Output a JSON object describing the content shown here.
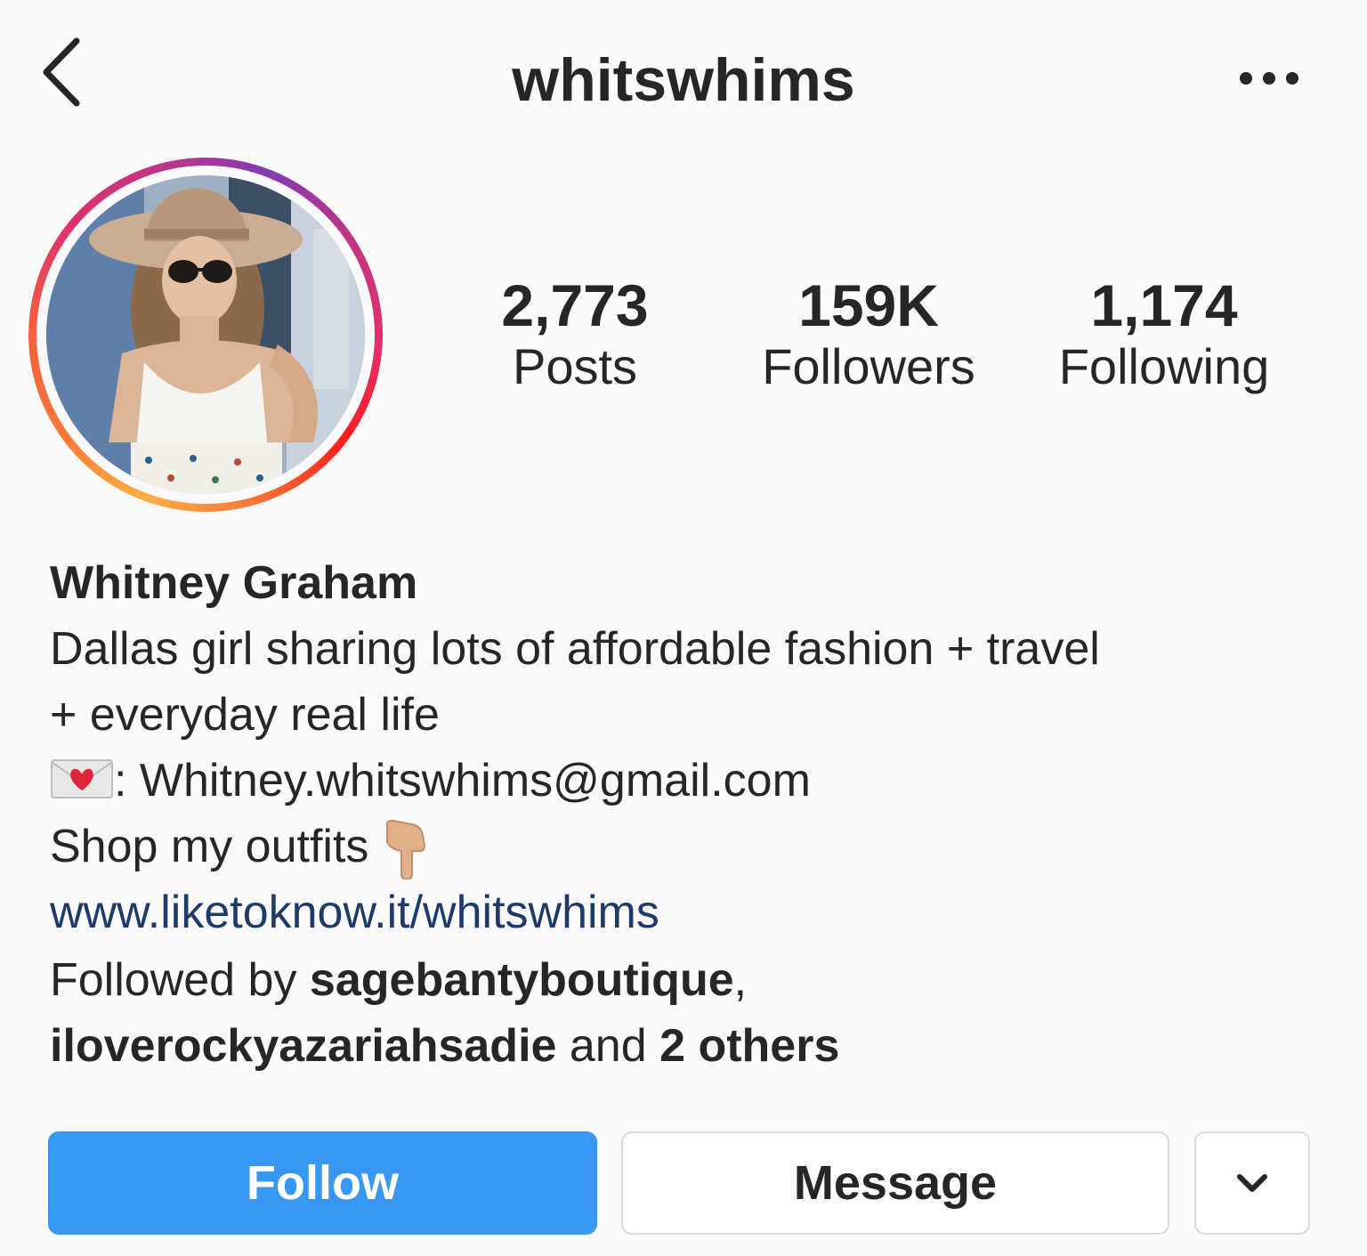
{
  "header": {
    "username": "whitswhims",
    "back_icon": "chevron-left-icon",
    "more_icon": "ellipsis-icon"
  },
  "stats": {
    "posts": {
      "value": "2,773",
      "label": "Posts"
    },
    "followers": {
      "value": "159K",
      "label": "Followers"
    },
    "following": {
      "value": "1,174",
      "label": "Following"
    }
  },
  "bio": {
    "full_name": "Whitney Graham",
    "line1": "Dallas girl sharing lots of affordable fashion + travel",
    "line2": "+ everyday real life",
    "email_icon": "love-letter-icon",
    "email_prefix": ": ",
    "email": "Whitney.whitswhims@gmail.com",
    "shop_text": "Shop my outfits ",
    "shop_icon": "pointing-down-icon",
    "link": "www.liketoknow.it/whitswhims",
    "followed_prefix": "Followed by ",
    "followed_user1": "sagebantyboutique",
    "followed_sep": ",",
    "followed_user2": "iloverockyazariahsadie",
    "followed_and": " and ",
    "followed_others": "2 others"
  },
  "actions": {
    "follow_label": "Follow",
    "message_label": "Message",
    "dropdown_icon": "chevron-down-icon"
  },
  "colors": {
    "follow_button": "#3897f0",
    "link": "#1e3a6b",
    "text": "#262626",
    "background": "#fafafa"
  }
}
